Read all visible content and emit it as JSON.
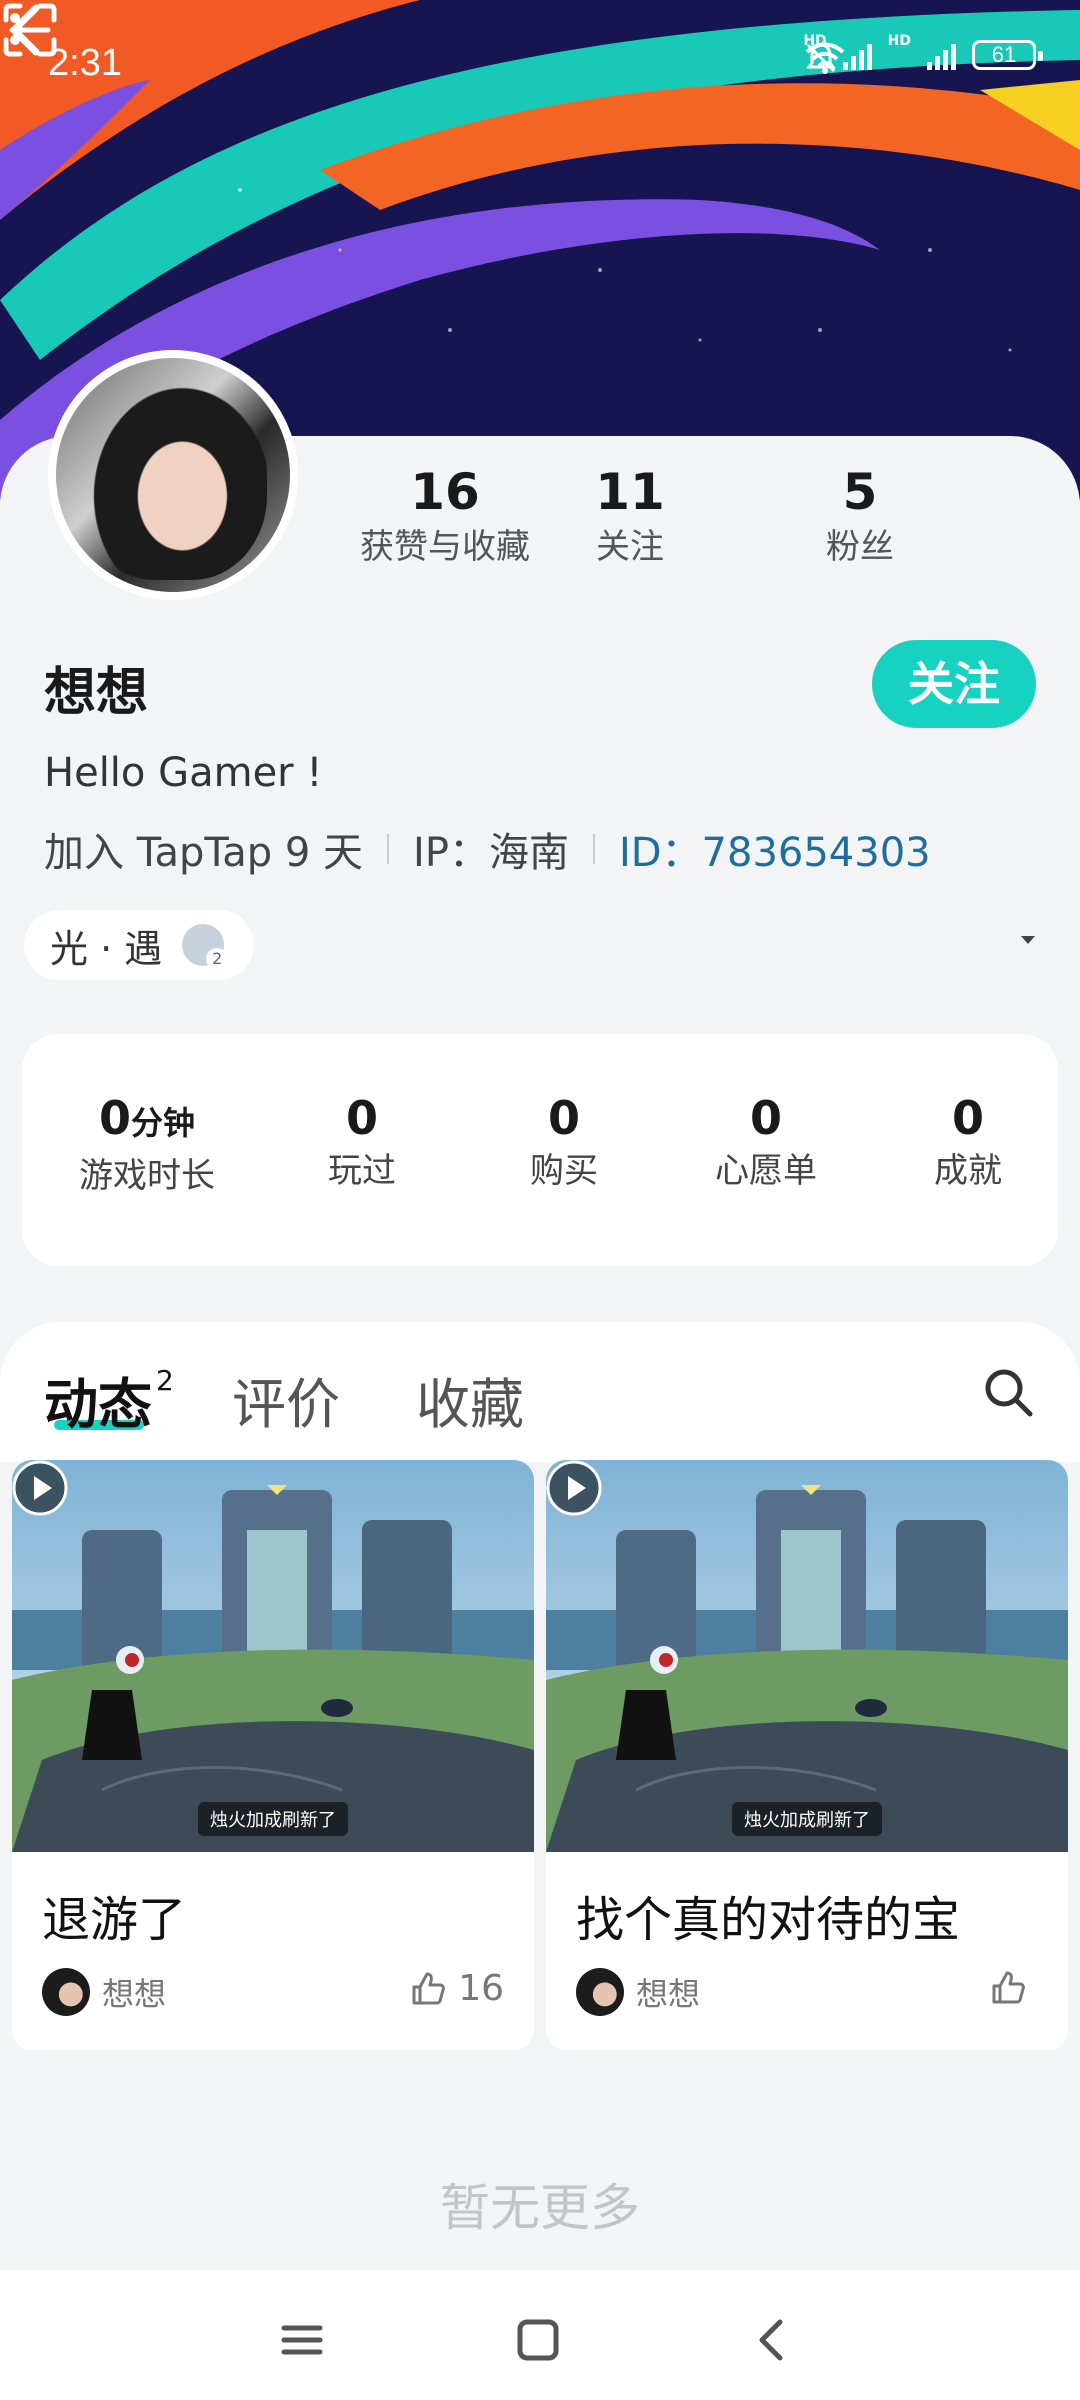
{
  "status_bar": {
    "time": "2:31",
    "hd_1": "HD",
    "hd_2": "HD",
    "battery": "61"
  },
  "colors": {
    "accent": "#17D1C1",
    "banner_bg": "#171452",
    "id_link": "#1E6D9C"
  },
  "icons": {
    "back": "back-arrow-icon",
    "scan": "scan-icon",
    "more": "more-vertical-icon",
    "search": "search-icon",
    "play": "play-icon",
    "like": "thumbs-up-icon"
  },
  "profile": {
    "name": "想想",
    "follow_label": "关注",
    "bio": "Hello Gamer !",
    "joined": "加入 TapTap 9 天",
    "ip": "IP：海南",
    "id": "ID：783654303",
    "stats": [
      {
        "value": "16",
        "label": "获赞与收藏"
      },
      {
        "value": "11",
        "label": "关注"
      },
      {
        "value": "5",
        "label": "粉丝"
      }
    ],
    "game_tag": "光 · 遇"
  },
  "game_stats": {
    "playtime_value": "0",
    "playtime_unit": "分钟",
    "playtime_label": "游戏时长",
    "items": [
      {
        "value": "0",
        "label": "玩过"
      },
      {
        "value": "0",
        "label": "购买"
      },
      {
        "value": "0",
        "label": "心愿单"
      },
      {
        "value": "0",
        "label": "成就"
      }
    ]
  },
  "tabs": {
    "moments": "动态",
    "moments_count": "2",
    "reviews": "评价",
    "favorites": "收藏"
  },
  "posts": [
    {
      "caption": "烛火加成刷新了",
      "title": "退游了",
      "author": "想想",
      "likes": "16"
    },
    {
      "caption": "烛火加成刷新了",
      "title": "找个真的对待的宝",
      "author": "想想",
      "likes": ""
    }
  ],
  "footer": {
    "no_more": "暂无更多"
  }
}
